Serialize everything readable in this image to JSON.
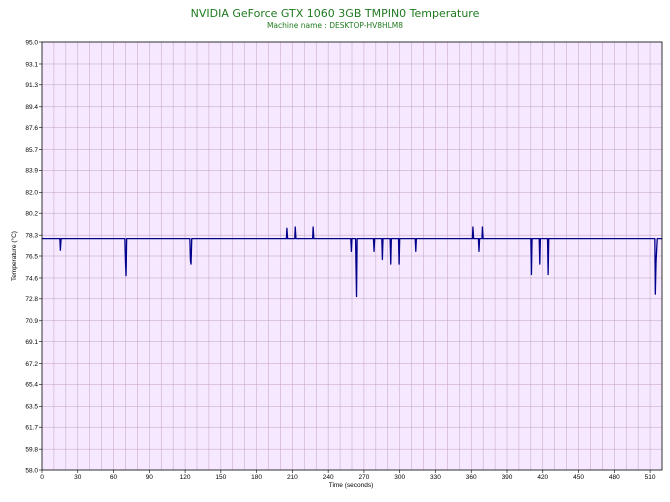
{
  "chart_data": {
    "type": "line",
    "title": "NVIDIA GeForce GTX 1060 3GB TMPIN0 Temperature",
    "subtitle": "Machine name : DESKTOP-HV8HLM8",
    "xlabel": "Time (seconds)",
    "ylabel": "Temperature (°C)",
    "xlim": [
      0,
      520
    ],
    "ylim": [
      58.0,
      95.0
    ],
    "xticks": [
      "0",
      "30",
      "60",
      "90",
      "120",
      "150",
      "180",
      "210",
      "240",
      "270",
      "300",
      "330",
      "360",
      "390",
      "420",
      "450",
      "480",
      "510"
    ],
    "yticks": [
      "58.0",
      "59.8",
      "61.7",
      "63.5",
      "65.4",
      "67.2",
      "69.1",
      "70.9",
      "72.8",
      "74.6",
      "76.5",
      "78.3",
      "80.2",
      "82.0",
      "83.9",
      "85.7",
      "87.6",
      "89.4",
      "91.3",
      "93.1",
      "95.0"
    ],
    "grid": true,
    "background_color": "#f6e8ff",
    "grid_color": "#c2a2c2",
    "line_color": "#00008b",
    "title_color": "#1f7a1f",
    "baseline": 78.0,
    "series": [
      {
        "values": [
          [
            0,
            78.0
          ],
          [
            15,
            78.0
          ],
          [
            15.4,
            77.0
          ],
          [
            16,
            78.0
          ],
          [
            69.5,
            78.0
          ],
          [
            70,
            76.0
          ],
          [
            70.5,
            74.8
          ],
          [
            71,
            78.0
          ],
          [
            124,
            78.0
          ],
          [
            124.5,
            76.1
          ],
          [
            125,
            75.8
          ],
          [
            125.6,
            78.0
          ],
          [
            205,
            78.0
          ],
          [
            205.4,
            78.9
          ],
          [
            206,
            78.0
          ],
          [
            212,
            78.0
          ],
          [
            212.4,
            79.0
          ],
          [
            213,
            78.0
          ],
          [
            227,
            78.0
          ],
          [
            227.4,
            79.0
          ],
          [
            228,
            78.0
          ],
          [
            259,
            78.0
          ],
          [
            259.5,
            76.9
          ],
          [
            260,
            78.0
          ],
          [
            263,
            78.0
          ],
          [
            263.3,
            76.0
          ],
          [
            263.8,
            73.0
          ],
          [
            264.3,
            78.0
          ],
          [
            278,
            78.0
          ],
          [
            278.5,
            76.9
          ],
          [
            279,
            78.0
          ],
          [
            285,
            78.0
          ],
          [
            285.5,
            76.2
          ],
          [
            286,
            78.0
          ],
          [
            292,
            78.0
          ],
          [
            292.5,
            75.8
          ],
          [
            293,
            78.0
          ],
          [
            299,
            78.0
          ],
          [
            299.5,
            75.8
          ],
          [
            300,
            78.0
          ],
          [
            313,
            78.0
          ],
          [
            313.5,
            76.9
          ],
          [
            314,
            78.0
          ],
          [
            361,
            78.0
          ],
          [
            361.4,
            79.0
          ],
          [
            362,
            78.0
          ],
          [
            366,
            78.0
          ],
          [
            366.5,
            76.9
          ],
          [
            367,
            78.0
          ],
          [
            369,
            78.0
          ],
          [
            369.4,
            79.0
          ],
          [
            370,
            78.0
          ],
          [
            410,
            78.0
          ],
          [
            410.5,
            74.9
          ],
          [
            411,
            78.0
          ],
          [
            417,
            78.0
          ],
          [
            417.5,
            75.8
          ],
          [
            418,
            78.0
          ],
          [
            424,
            78.0
          ],
          [
            424.5,
            74.9
          ],
          [
            425,
            78.0
          ],
          [
            514,
            78.0
          ],
          [
            514.4,
            73.2
          ],
          [
            515,
            76.0
          ],
          [
            516,
            78.0
          ],
          [
            520,
            78.0
          ]
        ]
      }
    ]
  }
}
